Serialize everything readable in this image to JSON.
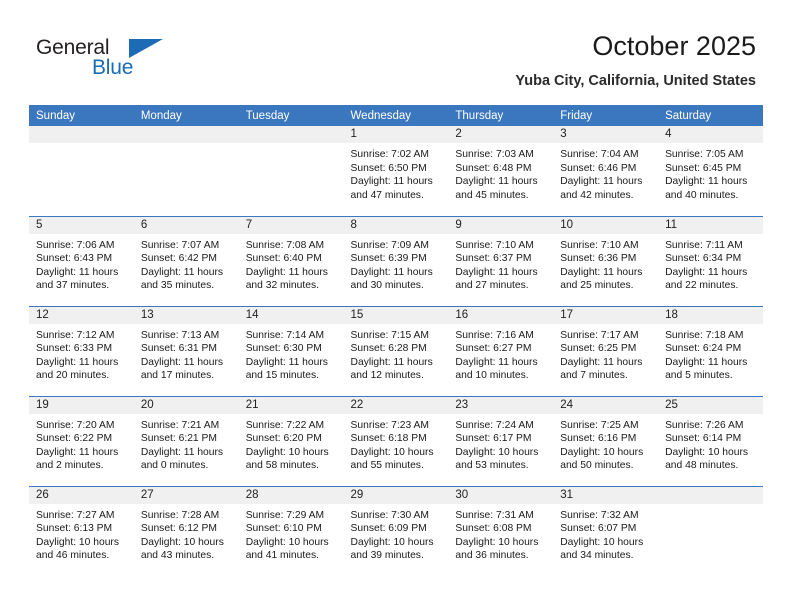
{
  "brand": {
    "name_part1": "General",
    "name_part2": "Blue",
    "triangle_color": "#1b6cb5"
  },
  "header": {
    "title": "October 2025",
    "subtitle": "Yuba City, California, United States"
  },
  "theme": {
    "header_blue": "#3b77bf",
    "daynum_background": "#f0f0f0",
    "text_color": "#1a1a1a"
  },
  "labels": {
    "sunrise_prefix": "Sunrise:",
    "sunset_prefix": "Sunset:",
    "daylight_prefix": "Daylight:"
  },
  "weekday_headers": [
    "Sunday",
    "Monday",
    "Tuesday",
    "Wednesday",
    "Thursday",
    "Friday",
    "Saturday"
  ],
  "weeks": [
    [
      {
        "day": "",
        "empty": true
      },
      {
        "day": "",
        "empty": true
      },
      {
        "day": "",
        "empty": true
      },
      {
        "day": "1",
        "sunrise": "Sunrise: 7:02 AM",
        "sunset": "Sunset: 6:50 PM",
        "daylight_line1": "Daylight: 11 hours",
        "daylight_line2": "and 47 minutes."
      },
      {
        "day": "2",
        "sunrise": "Sunrise: 7:03 AM",
        "sunset": "Sunset: 6:48 PM",
        "daylight_line1": "Daylight: 11 hours",
        "daylight_line2": "and 45 minutes."
      },
      {
        "day": "3",
        "sunrise": "Sunrise: 7:04 AM",
        "sunset": "Sunset: 6:46 PM",
        "daylight_line1": "Daylight: 11 hours",
        "daylight_line2": "and 42 minutes."
      },
      {
        "day": "4",
        "sunrise": "Sunrise: 7:05 AM",
        "sunset": "Sunset: 6:45 PM",
        "daylight_line1": "Daylight: 11 hours",
        "daylight_line2": "and 40 minutes."
      }
    ],
    [
      {
        "day": "5",
        "sunrise": "Sunrise: 7:06 AM",
        "sunset": "Sunset: 6:43 PM",
        "daylight_line1": "Daylight: 11 hours",
        "daylight_line2": "and 37 minutes."
      },
      {
        "day": "6",
        "sunrise": "Sunrise: 7:07 AM",
        "sunset": "Sunset: 6:42 PM",
        "daylight_line1": "Daylight: 11 hours",
        "daylight_line2": "and 35 minutes."
      },
      {
        "day": "7",
        "sunrise": "Sunrise: 7:08 AM",
        "sunset": "Sunset: 6:40 PM",
        "daylight_line1": "Daylight: 11 hours",
        "daylight_line2": "and 32 minutes."
      },
      {
        "day": "8",
        "sunrise": "Sunrise: 7:09 AM",
        "sunset": "Sunset: 6:39 PM",
        "daylight_line1": "Daylight: 11 hours",
        "daylight_line2": "and 30 minutes."
      },
      {
        "day": "9",
        "sunrise": "Sunrise: 7:10 AM",
        "sunset": "Sunset: 6:37 PM",
        "daylight_line1": "Daylight: 11 hours",
        "daylight_line2": "and 27 minutes."
      },
      {
        "day": "10",
        "sunrise": "Sunrise: 7:10 AM",
        "sunset": "Sunset: 6:36 PM",
        "daylight_line1": "Daylight: 11 hours",
        "daylight_line2": "and 25 minutes."
      },
      {
        "day": "11",
        "sunrise": "Sunrise: 7:11 AM",
        "sunset": "Sunset: 6:34 PM",
        "daylight_line1": "Daylight: 11 hours",
        "daylight_line2": "and 22 minutes."
      }
    ],
    [
      {
        "day": "12",
        "sunrise": "Sunrise: 7:12 AM",
        "sunset": "Sunset: 6:33 PM",
        "daylight_line1": "Daylight: 11 hours",
        "daylight_line2": "and 20 minutes."
      },
      {
        "day": "13",
        "sunrise": "Sunrise: 7:13 AM",
        "sunset": "Sunset: 6:31 PM",
        "daylight_line1": "Daylight: 11 hours",
        "daylight_line2": "and 17 minutes."
      },
      {
        "day": "14",
        "sunrise": "Sunrise: 7:14 AM",
        "sunset": "Sunset: 6:30 PM",
        "daylight_line1": "Daylight: 11 hours",
        "daylight_line2": "and 15 minutes."
      },
      {
        "day": "15",
        "sunrise": "Sunrise: 7:15 AM",
        "sunset": "Sunset: 6:28 PM",
        "daylight_line1": "Daylight: 11 hours",
        "daylight_line2": "and 12 minutes."
      },
      {
        "day": "16",
        "sunrise": "Sunrise: 7:16 AM",
        "sunset": "Sunset: 6:27 PM",
        "daylight_line1": "Daylight: 11 hours",
        "daylight_line2": "and 10 minutes."
      },
      {
        "day": "17",
        "sunrise": "Sunrise: 7:17 AM",
        "sunset": "Sunset: 6:25 PM",
        "daylight_line1": "Daylight: 11 hours",
        "daylight_line2": "and 7 minutes."
      },
      {
        "day": "18",
        "sunrise": "Sunrise: 7:18 AM",
        "sunset": "Sunset: 6:24 PM",
        "daylight_line1": "Daylight: 11 hours",
        "daylight_line2": "and 5 minutes."
      }
    ],
    [
      {
        "day": "19",
        "sunrise": "Sunrise: 7:20 AM",
        "sunset": "Sunset: 6:22 PM",
        "daylight_line1": "Daylight: 11 hours",
        "daylight_line2": "and 2 minutes."
      },
      {
        "day": "20",
        "sunrise": "Sunrise: 7:21 AM",
        "sunset": "Sunset: 6:21 PM",
        "daylight_line1": "Daylight: 11 hours",
        "daylight_line2": "and 0 minutes."
      },
      {
        "day": "21",
        "sunrise": "Sunrise: 7:22 AM",
        "sunset": "Sunset: 6:20 PM",
        "daylight_line1": "Daylight: 10 hours",
        "daylight_line2": "and 58 minutes."
      },
      {
        "day": "22",
        "sunrise": "Sunrise: 7:23 AM",
        "sunset": "Sunset: 6:18 PM",
        "daylight_line1": "Daylight: 10 hours",
        "daylight_line2": "and 55 minutes."
      },
      {
        "day": "23",
        "sunrise": "Sunrise: 7:24 AM",
        "sunset": "Sunset: 6:17 PM",
        "daylight_line1": "Daylight: 10 hours",
        "daylight_line2": "and 53 minutes."
      },
      {
        "day": "24",
        "sunrise": "Sunrise: 7:25 AM",
        "sunset": "Sunset: 6:16 PM",
        "daylight_line1": "Daylight: 10 hours",
        "daylight_line2": "and 50 minutes."
      },
      {
        "day": "25",
        "sunrise": "Sunrise: 7:26 AM",
        "sunset": "Sunset: 6:14 PM",
        "daylight_line1": "Daylight: 10 hours",
        "daylight_line2": "and 48 minutes."
      }
    ],
    [
      {
        "day": "26",
        "sunrise": "Sunrise: 7:27 AM",
        "sunset": "Sunset: 6:13 PM",
        "daylight_line1": "Daylight: 10 hours",
        "daylight_line2": "and 46 minutes."
      },
      {
        "day": "27",
        "sunrise": "Sunrise: 7:28 AM",
        "sunset": "Sunset: 6:12 PM",
        "daylight_line1": "Daylight: 10 hours",
        "daylight_line2": "and 43 minutes."
      },
      {
        "day": "28",
        "sunrise": "Sunrise: 7:29 AM",
        "sunset": "Sunset: 6:10 PM",
        "daylight_line1": "Daylight: 10 hours",
        "daylight_line2": "and 41 minutes."
      },
      {
        "day": "29",
        "sunrise": "Sunrise: 7:30 AM",
        "sunset": "Sunset: 6:09 PM",
        "daylight_line1": "Daylight: 10 hours",
        "daylight_line2": "and 39 minutes."
      },
      {
        "day": "30",
        "sunrise": "Sunrise: 7:31 AM",
        "sunset": "Sunset: 6:08 PM",
        "daylight_line1": "Daylight: 10 hours",
        "daylight_line2": "and 36 minutes."
      },
      {
        "day": "31",
        "sunrise": "Sunrise: 7:32 AM",
        "sunset": "Sunset: 6:07 PM",
        "daylight_line1": "Daylight: 10 hours",
        "daylight_line2": "and 34 minutes."
      },
      {
        "day": "",
        "empty": true
      }
    ]
  ]
}
